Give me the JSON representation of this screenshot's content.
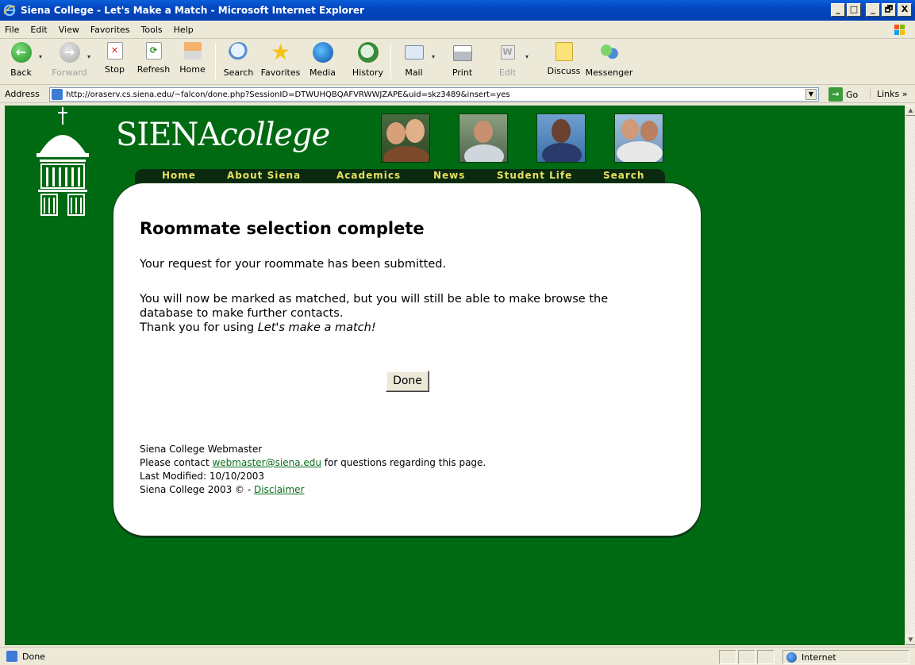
{
  "window": {
    "title": "Siena College - Let's Make a Match - Microsoft Internet Explorer",
    "controls": [
      "_",
      "□",
      "_",
      "🗗",
      "X"
    ]
  },
  "menubar": {
    "items": [
      {
        "label": "File"
      },
      {
        "label": "Edit"
      },
      {
        "label": "View"
      },
      {
        "label": "Favorites"
      },
      {
        "label": "Tools"
      },
      {
        "label": "Help"
      }
    ]
  },
  "toolbar": {
    "back": "Back",
    "forward": "Forward",
    "stop": "Stop",
    "refresh": "Refresh",
    "home": "Home",
    "search": "Search",
    "favorites": "Favorites",
    "media": "Media",
    "history": "History",
    "mail": "Mail",
    "print": "Print",
    "edit": "Edit",
    "discuss": "Discuss",
    "messenger": "Messenger"
  },
  "addressbar": {
    "label": "Address",
    "url": "http://oraserv.cs.siena.edu/~falcon/done.php?SessionID=DTWUHQBQAFVRWWJZAPE&uid=skz3489&insert=yes",
    "go": "Go",
    "links": "Links »"
  },
  "site": {
    "logo_main": "SIENA",
    "logo_italic": "college",
    "nav": [
      "Home",
      "About Siena",
      "Academics",
      "News",
      "Student Life",
      "Search"
    ]
  },
  "content": {
    "heading": "Roommate selection complete",
    "submitted": "Your request for your roommate has been submitted.",
    "matched_line1": "You will now be marked as matched, but you will still be able to make browse the",
    "matched_line2": "database to make further contacts.",
    "thanks_prefix": "Thank you for using ",
    "thanks_italic": "Let's make a match!",
    "done_button": "Done"
  },
  "footer": {
    "webmaster": "Siena College Webmaster",
    "contact_prefix": "Please contact ",
    "contact_email": "webmaster@siena.edu",
    "contact_suffix": " for questions regarding this page.",
    "last_modified": "Last Modified: 10/10/2003",
    "copyright_prefix": "Siena College 2003 © - ",
    "disclaimer": "Disclaimer"
  },
  "statusbar": {
    "text": "Done",
    "zone": "Internet"
  }
}
